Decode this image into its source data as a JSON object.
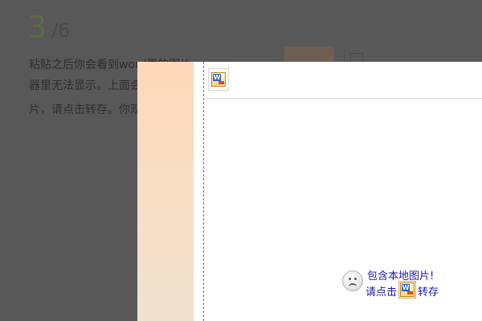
{
  "background": {
    "step_current": "3",
    "step_total": "/6",
    "paragraph_lines": [
      "粘贴之后你会看到word里的图片",
      "器里无法显示。上面会",
      "片，请点击转存。你观"
    ]
  },
  "popup": {
    "toolbar": {
      "word_button_icon": "word-document-icon"
    },
    "notice": {
      "line1": "包含本地图片!",
      "line2_prefix": "请点击",
      "line2_suffix": "转存",
      "icon": "sad-face-icon"
    }
  },
  "colors": {
    "overlay": "#585858",
    "notice_text": "#1a1aa8",
    "strip_top": "#fed8ba",
    "dash": "#c04a6a"
  }
}
